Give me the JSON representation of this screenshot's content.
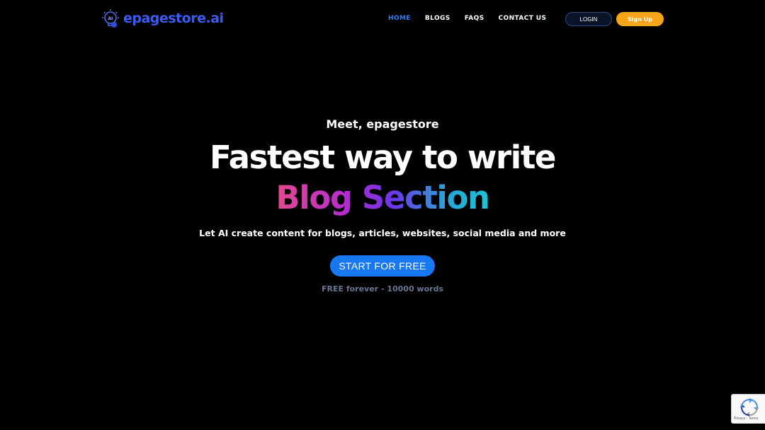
{
  "header": {
    "logo_text": "epagestore.ai",
    "nav": [
      {
        "label": "HOME",
        "active": true
      },
      {
        "label": "BLOGS",
        "active": false
      },
      {
        "label": "FAQS",
        "active": false
      },
      {
        "label": "CONTACT US",
        "active": false
      }
    ],
    "login_label": "LOGIN",
    "signup_label": "Sign Up"
  },
  "hero": {
    "eyebrow": "Meet, epagestore",
    "headline": "Fastest way to write",
    "gradient_text": "Blog Section",
    "subtitle": "Let AI create content for blogs, articles, websites, social media and more",
    "cta_label": "START FOR FREE",
    "free_note": "FREE forever - 10000 words"
  },
  "recaptcha": {
    "terms": "Privacy - Terms"
  },
  "colors": {
    "background": "#000000",
    "brand_blue": "#3b5bf5",
    "nav_active": "#2f7cf6",
    "cta_blue": "#1877f2",
    "signup_orange": "#f5a517",
    "muted_note": "#6a7590"
  },
  "icons": {
    "logo": "lightbulb-ai-icon",
    "recaptcha": "recaptcha-icon"
  }
}
